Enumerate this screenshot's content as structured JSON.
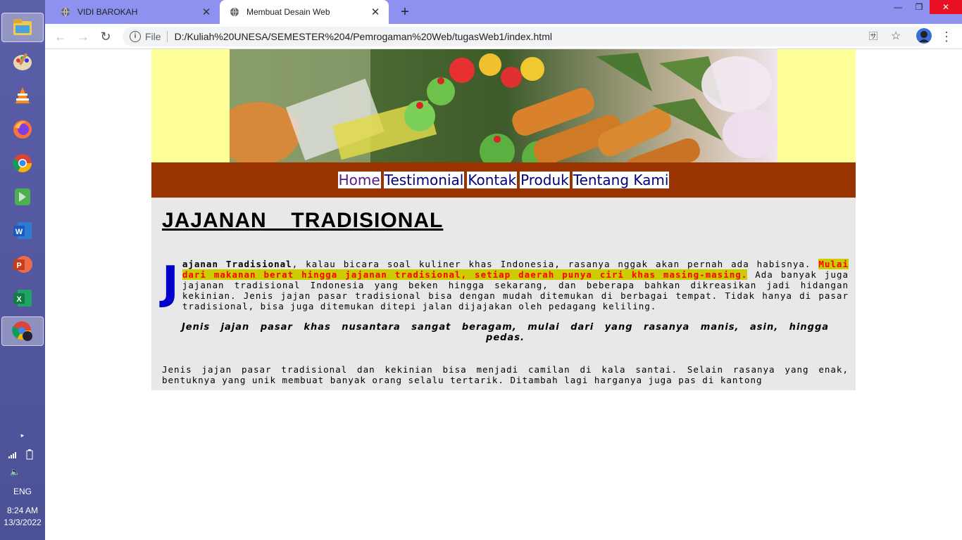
{
  "browser": {
    "tabs": [
      {
        "title": "VIDI BAROKAH",
        "active": false
      },
      {
        "title": "Membuat Desain Web",
        "active": true
      }
    ],
    "url_scheme_label": "File",
    "url": "D:/Kuliah%20UNESA/SEMESTER%204/Pemrogaman%20Web/tugasWeb1/index.html"
  },
  "taskbar": {
    "apps": [
      "file-explorer-icon",
      "paint-icon",
      "vlc-icon",
      "firefox-icon",
      "chrome-icon",
      "camtasia-icon",
      "word-icon",
      "powerpoint-icon",
      "excel-icon",
      "chrome-profile-icon"
    ],
    "language": "ENG",
    "time": "8:24 AM",
    "date": "13/3/2022"
  },
  "site": {
    "nav": [
      "Home",
      "Testimonial",
      "Kontak",
      "Produk",
      "Tentang Kami"
    ],
    "heading": "JAJANAN  TRADISIONAL",
    "p1_dropcap": "J",
    "p1_bold": "ajanan Tradisional",
    "p1_text": ", kalau bicara soal kuliner khas Indonesia, rasanya nggak akan pernah ada habisnya. ",
    "p1_highlight": "Mulai dari makanan berat hingga jajanan tradisional, setiap daerah punya ciri khas masing-masing.",
    "p1_rest": " Ada banyak juga jajanan tradisional Indonesia yang beken hingga sekarang, dan beberapa bahkan dikreasikan jadi hidangan kekinian. Jenis jajan pasar tradisional bisa dengan mudah ditemukan di berbagai tempat. Tidak hanya di pasar tradisional, bisa juga ditemukan ditepi jalan dijajakan oleh pedagang keliling.",
    "quote": "Jenis jajan pasar khas nusantara sangat beragam, mulai dari yang rasanya manis, asin, hingga pedas.",
    "p2": "Jenis jajan pasar tradisional dan kekinian bisa menjadi camilan di kala santai. Selain rasanya yang enak, bentuknya yang unik membuat banyak orang selalu tertarik. Ditambah lagi harganya juga pas di kantong"
  },
  "colors": {
    "header_bg": "#ffff99",
    "nav_bg": "#993300",
    "content_bg": "#e8e8e8",
    "dropcap": "#0000cc",
    "highlight_bg": "#cccc00",
    "highlight_text": "#ff0000",
    "tabstrip": "#8f91f0"
  }
}
